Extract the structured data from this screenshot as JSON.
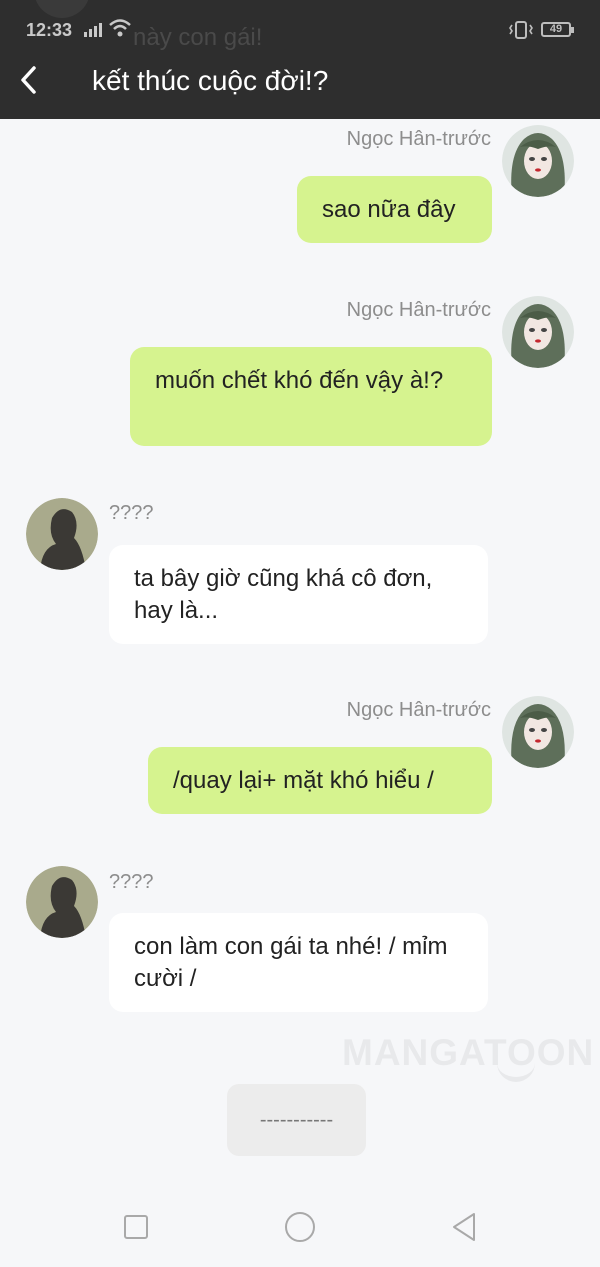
{
  "status_bar": {
    "time": "12:33",
    "battery": "49",
    "behind_text": "này con gái!"
  },
  "header": {
    "title": "kết thúc cuộc đời!?"
  },
  "messages": [
    {
      "side": "right",
      "sender": "Ngọc Hân-trước",
      "text": "sao nữa đây"
    },
    {
      "side": "right",
      "sender": "Ngọc Hân-trước",
      "text": "muốn chết khó đến vậy à!?"
    },
    {
      "side": "left",
      "sender": "????",
      "text": "ta bây giờ cũng khá cô đơn, hay là..."
    },
    {
      "side": "right",
      "sender": "Ngọc Hân-trước",
      "text": "/quay lại+ mặt khó hiểu /"
    },
    {
      "side": "left",
      "sender": "????",
      "text": "con làm con gái ta nhé! / mỉm cười /"
    }
  ],
  "watermark": "MANGATOON",
  "continue_button": "-----------",
  "colors": {
    "header_bg": "#2e2e2e",
    "my_bubble": "#d6f38f",
    "their_bubble": "#ffffff",
    "background": "#f6f7f9"
  },
  "icons": {
    "back": "chevron-left-icon",
    "nav_recent": "square-icon",
    "nav_home": "circle-icon",
    "nav_back": "triangle-back-icon"
  }
}
